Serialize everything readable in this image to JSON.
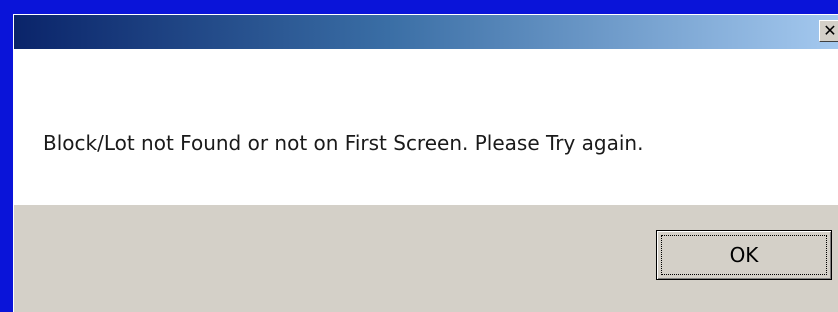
{
  "dialog": {
    "title": "",
    "close_icon": "close-icon",
    "close_glyph": "✕",
    "message": "Block/Lot not Found or not on First Screen.  Please Try again.",
    "ok_label": "OK"
  },
  "colors": {
    "desktop": "#0a14d9",
    "titlebar_start": "#0a246a",
    "titlebar_end": "#a6caf0",
    "dialog_face": "#d4d0c8",
    "message_bg": "#ffffff"
  }
}
